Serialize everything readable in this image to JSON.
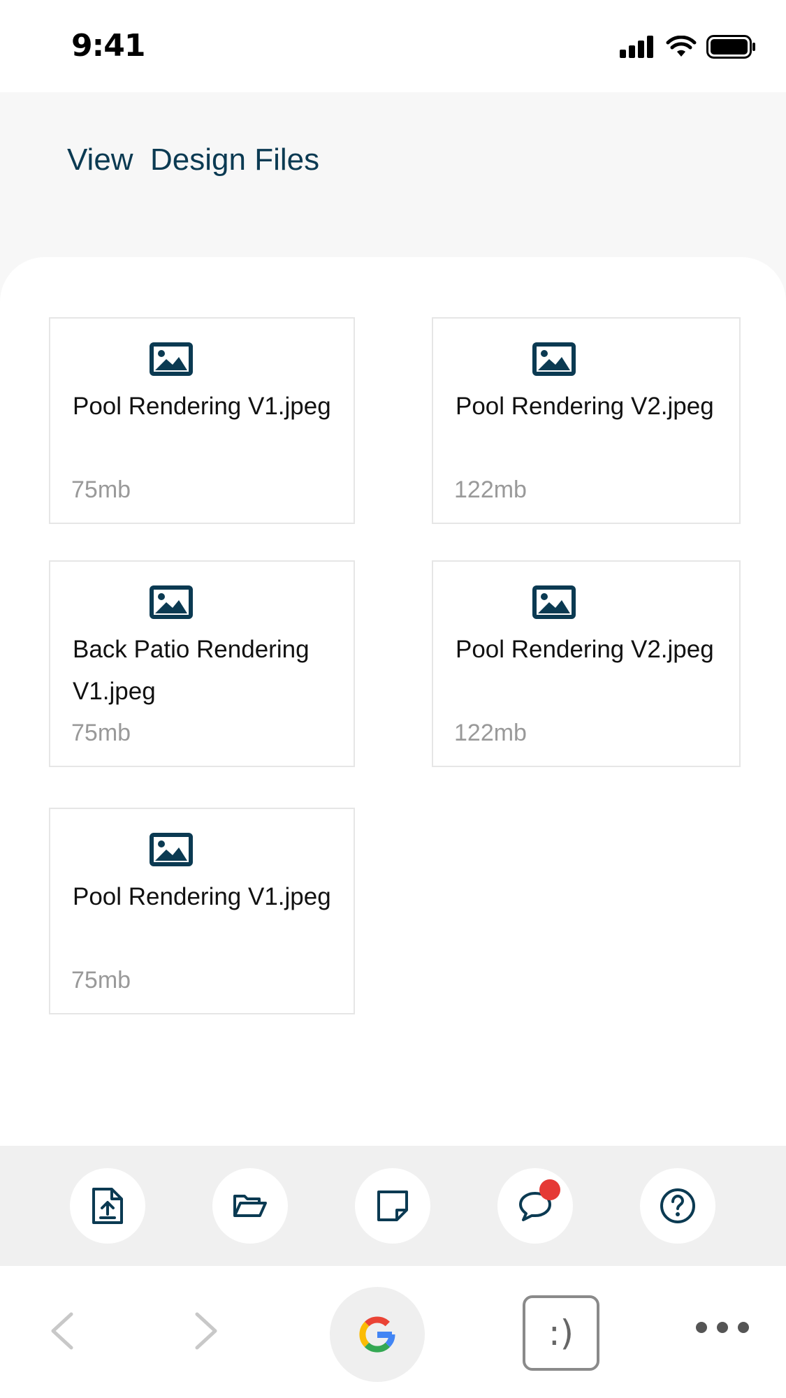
{
  "status_bar": {
    "time": "9:41"
  },
  "header": {
    "title": "View  Design Files"
  },
  "files": [
    {
      "name": "Pool Rendering V1.jpeg",
      "size": "75mb",
      "icon": "image-icon"
    },
    {
      "name": "Pool Rendering V2.jpeg",
      "size": "122mb",
      "icon": "image-icon"
    },
    {
      "name": "Back Patio Rendering V1.jpeg",
      "size": "75mb",
      "icon": "image-icon"
    },
    {
      "name": "Pool Rendering V2.jpeg",
      "size": "122mb",
      "icon": "image-icon"
    },
    {
      "name": "Pool Rendering V1.jpeg",
      "size": "75mb",
      "icon": "image-icon"
    }
  ],
  "action_bar": {
    "items": [
      {
        "icon": "file-upload-icon"
      },
      {
        "icon": "folder-open-icon"
      },
      {
        "icon": "note-icon"
      },
      {
        "icon": "chat-icon",
        "notification": true
      },
      {
        "icon": "help-icon"
      }
    ]
  },
  "browser_bar": {
    "tabs_label": ":)"
  },
  "colors": {
    "brand": "#0b3a52",
    "notification": "#e53935",
    "muted_text": "#999999",
    "background": "#f7f7f7"
  }
}
